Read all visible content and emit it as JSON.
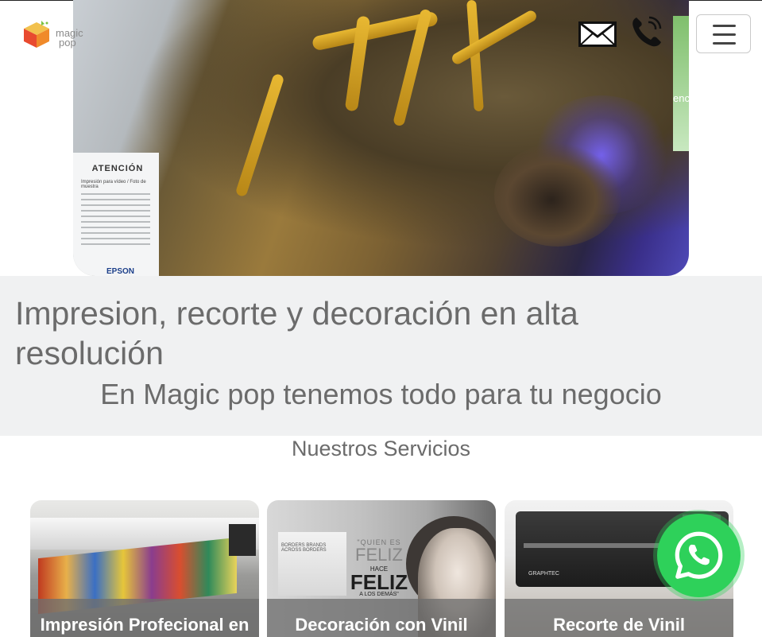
{
  "header": {
    "logo": {
      "brand_line1": "magic",
      "brand_line2": "pop"
    },
    "icons": {
      "mail": "envelope-icon",
      "phone": "phone-icon",
      "menu": "hamburger-menu-icon"
    }
  },
  "hero": {
    "notice_title": "ATENCIÓN",
    "notice_subtitle": "Impresión para vídeo / Foto de muestra",
    "notice_brand": "EPSON",
    "sideband_text": "encia"
  },
  "intro": {
    "heading": "Impresion, recorte y decoración en alta resolución",
    "tagline": "En Magic pop tenemos todo para tu negocio"
  },
  "services": {
    "title": "Nuestros Servicios",
    "cards": [
      {
        "caption": "Impresión Profecional en"
      },
      {
        "caption": "Decoración con Vinil",
        "banner_text": "BORDERS BRANDS ACROSS BORDERS",
        "poster_line1": "\"QUIEN ES",
        "poster_line2": "FELIZ",
        "poster_line3": "HACE",
        "poster_line4": "FELIZ",
        "poster_line5": "A LOS DEMÁS\""
      },
      {
        "caption": "Recorte de Vinil",
        "machine_brand": "GRAPHTEC"
      }
    ]
  },
  "whatsapp": {
    "icon": "whatsapp-icon",
    "color": "#2ed15a"
  }
}
